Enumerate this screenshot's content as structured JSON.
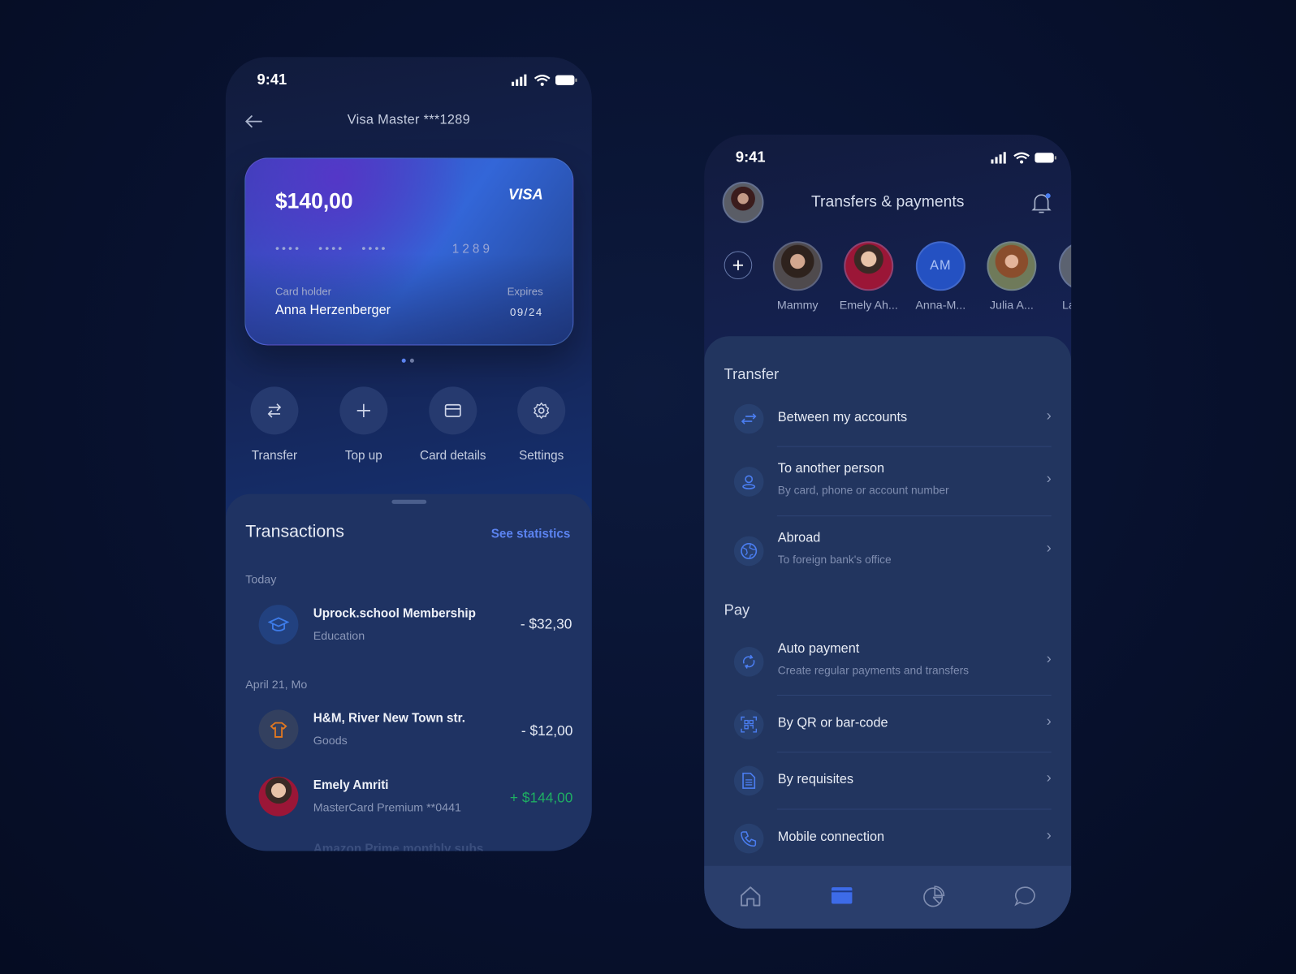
{
  "card_screen": {
    "status_time": "9:41",
    "title": "Visa Master ***1289",
    "card": {
      "balance": "$140,00",
      "brand": "VISA",
      "masked_number": "••••   ••••   ••••",
      "last4": "1289",
      "holder_label": "Card holder",
      "holder_name": "Anna Herzenberger",
      "expires_label": "Expires",
      "expires": "09/24",
      "page_count": 2,
      "active_page": 1
    },
    "actions": [
      {
        "label": "Transfer",
        "icon": "transfer-arrows-icon"
      },
      {
        "label": "Top up",
        "icon": "plus-icon"
      },
      {
        "label": "Card details",
        "icon": "card-icon"
      },
      {
        "label": "Settings",
        "icon": "gear-icon"
      }
    ],
    "transactions": {
      "title": "Transactions",
      "link": "See statistics",
      "groups": [
        {
          "date": "Today",
          "items": [
            {
              "title": "Uprock.school Membership",
              "subtitle": "Education",
              "amount": "- $32,30",
              "icon": "graduation-cap-icon"
            }
          ]
        },
        {
          "date": "April 21, Mo",
          "items": [
            {
              "title": "H&M, River New Town str.",
              "subtitle": "Goods",
              "amount": "- $12,00",
              "icon": "tshirt-icon"
            },
            {
              "title": "Emely Amriti",
              "subtitle": "MasterCard Premium **0441",
              "amount": "+ $144,00",
              "icon": "avatar"
            }
          ]
        }
      ],
      "partial_item": "Amazon Prime monthly subs"
    },
    "colors": {
      "accent": "#5b83f0",
      "positive": "#1fae63"
    }
  },
  "transfers_screen": {
    "status_time": "9:41",
    "title": "Transfers & payments",
    "contacts": [
      {
        "name": "Mammy"
      },
      {
        "name": "Emely Ah..."
      },
      {
        "name": "Anna-M...",
        "initials": "AM"
      },
      {
        "name": "Julia A..."
      },
      {
        "name": "La"
      }
    ],
    "sections": [
      {
        "title": "Transfer",
        "items": [
          {
            "title": "Between my accounts",
            "subtitle": "",
            "icon": "swap-arrows-icon"
          },
          {
            "title": "To another person",
            "subtitle": "By card, phone or account number",
            "icon": "person-icon"
          },
          {
            "title": "Abroad",
            "subtitle": "To foreign bank's office",
            "icon": "globe-icon"
          }
        ]
      },
      {
        "title": "Pay",
        "items": [
          {
            "title": "Auto payment",
            "subtitle": "Create regular payments and transfers",
            "icon": "refresh-icon"
          },
          {
            "title": "By QR or bar-code",
            "subtitle": "",
            "icon": "qr-code-icon"
          },
          {
            "title": "By requisites",
            "subtitle": "",
            "icon": "document-icon"
          },
          {
            "title": "Mobile connection",
            "subtitle": "",
            "icon": "phone-icon"
          }
        ]
      }
    ],
    "nav": [
      {
        "icon": "home-icon",
        "active": false
      },
      {
        "icon": "card-icon",
        "active": true
      },
      {
        "icon": "pie-chart-icon",
        "active": false
      },
      {
        "icon": "chat-icon",
        "active": false
      }
    ]
  }
}
